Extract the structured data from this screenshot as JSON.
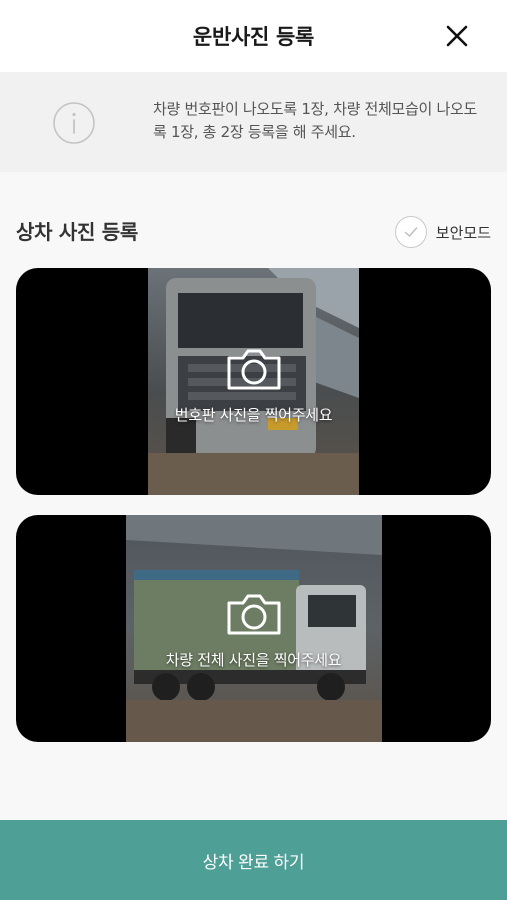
{
  "header": {
    "title": "운반사진 등록",
    "close_icon": "close-icon"
  },
  "info": {
    "icon": "info-icon",
    "text": "차량 번호판이 나오도록 1장, 차량 전체모습이 나오도록 1장, 총 2장 등록을 해 주세요."
  },
  "section": {
    "title": "상차 사진 등록",
    "secure_mode_label": "보안모드",
    "secure_mode_icon": "check-icon"
  },
  "photos": [
    {
      "label": "번호판 사진을 찍어주세요",
      "icon": "camera-icon"
    },
    {
      "label": "차량 전체 사진을 찍어주세요",
      "icon": "camera-icon"
    }
  ],
  "footer": {
    "button_label": "상차 완료 하기"
  },
  "colors": {
    "accent": "#4e9f96",
    "header_bg": "#ffffff",
    "info_bg": "#f1f1f1",
    "page_bg": "#f8f8f8"
  }
}
